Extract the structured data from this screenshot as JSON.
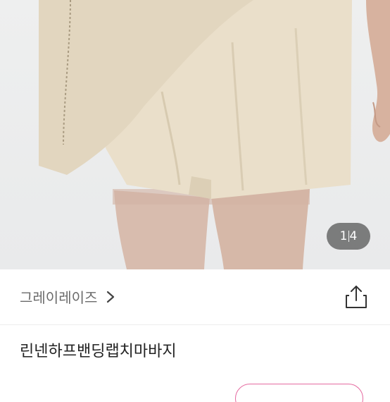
{
  "gallery": {
    "current": "1",
    "total": "4"
  },
  "shop": {
    "name": "그레이레이즈"
  },
  "product": {
    "title": "린넨하프밴딩랩치마바지"
  },
  "colors": {
    "fabric": "#eadfca",
    "accent": "#e56aa0"
  }
}
